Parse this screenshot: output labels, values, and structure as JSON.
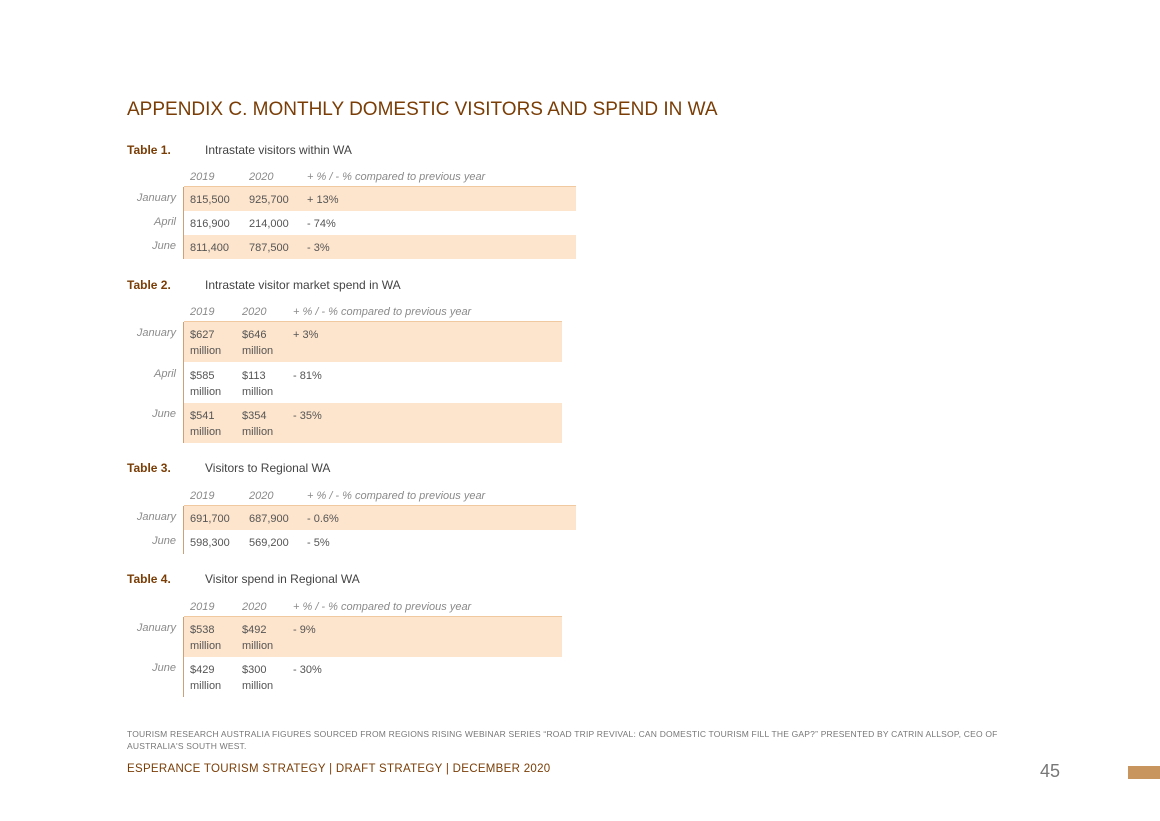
{
  "title": "APPENDIX C. MONTHLY DOMESTIC VISITORS AND SPEND IN WA",
  "columns": {
    "y2019": "2019",
    "y2020": "2020",
    "change": "+ % / - % compared to previous year"
  },
  "tables": [
    {
      "num": "Table 1.",
      "caption": "Intrastate visitors within WA",
      "rows": [
        {
          "month": "January",
          "v2019": "815,500",
          "v2020": "925,700",
          "change": "+ 13%"
        },
        {
          "month": "April",
          "v2019": "816,900",
          "v2020": "214,000",
          "change": "- 74%"
        },
        {
          "month": "June",
          "v2019": "811,400",
          "v2020": "787,500",
          "change": "- 3%"
        }
      ]
    },
    {
      "num": "Table 2.",
      "caption": "Intrastate visitor market spend in WA",
      "rows": [
        {
          "month": "January",
          "v2019": "$627",
          "v2019b": "million",
          "v2020": "$646",
          "v2020b": "million",
          "change": "+ 3%"
        },
        {
          "month": "April",
          "v2019": "$585",
          "v2019b": "million",
          "v2020": "$113",
          "v2020b": "million",
          "change": "- 81%"
        },
        {
          "month": "June",
          "v2019": "$541",
          "v2019b": "million",
          "v2020": "$354",
          "v2020b": "million",
          "change": "- 35%"
        }
      ]
    },
    {
      "num": "Table 3.",
      "caption": "Visitors to Regional WA",
      "rows": [
        {
          "month": "January",
          "v2019": "691,700",
          "v2020": "687,900",
          "change": "- 0.6%"
        },
        {
          "month": "June",
          "v2019": "598,300",
          "v2020": "569,200",
          "change": "- 5%"
        }
      ]
    },
    {
      "num": "Table 4.",
      "caption": "Visitor spend in Regional WA",
      "rows": [
        {
          "month": "January",
          "v2019": "$538",
          "v2019b": "million",
          "v2020": "$492",
          "v2020b": "million",
          "change": "- 9%"
        },
        {
          "month": "June",
          "v2019": "$429",
          "v2019b": "million",
          "v2020": "$300",
          "v2020b": "million",
          "change": "- 30%"
        }
      ]
    }
  ],
  "source_note": "Tourism Research Australia figures sourced from Regions Rising webinar series “Road Trip Revival: Can domestic tourism fill the gap?” presented by Catrin Allsop, CEO of Australia's South West.",
  "footer": "ESPERANCE TOURISM STRATEGY  |  DRAFT STRATEGY | DECEMBER 2020",
  "page_number": "45",
  "colors": {
    "accent": "#7a3d06",
    "row_fill": "#fde4cc",
    "tab": "#c9955e"
  }
}
